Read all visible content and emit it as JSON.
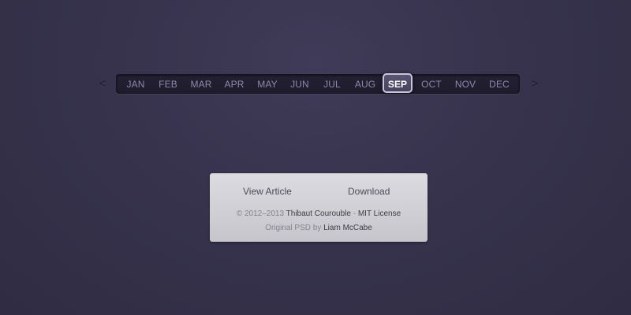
{
  "month_selector": {
    "prev_label": "<",
    "next_label": ">",
    "months": [
      "JAN",
      "FEB",
      "MAR",
      "APR",
      "MAY",
      "JUN",
      "JUL",
      "AUG",
      "SEP",
      "OCT",
      "NOV",
      "DEC"
    ],
    "selected": "SEP"
  },
  "footer_card": {
    "view_article_label": "View Article",
    "download_label": "Download",
    "copyright_text": "© 2012–2013",
    "author_link": "Thibaut Courouble",
    "separator": "-",
    "license_link": "MIT License",
    "psd_text": "Original PSD by",
    "psd_author_link": "Liam McCabe"
  }
}
